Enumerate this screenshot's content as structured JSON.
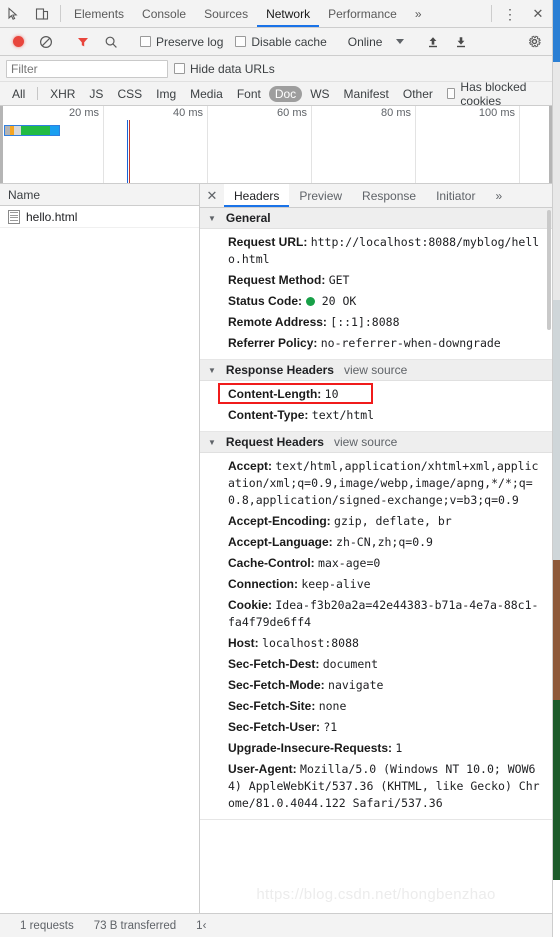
{
  "window": {
    "inspect_icon": "inspect-element-icon",
    "device_icon": "device-toolbar-icon",
    "more_tabs_icon": "»",
    "kebab_icon": "⋮",
    "close_icon": "✕"
  },
  "main_tabs": [
    {
      "label": "Elements",
      "active": false
    },
    {
      "label": "Console",
      "active": false
    },
    {
      "label": "Sources",
      "active": false
    },
    {
      "label": "Network",
      "active": true
    },
    {
      "label": "Performance",
      "active": false
    }
  ],
  "toolbar": {
    "record_icon": "record-button",
    "clear_icon": "clear-icon",
    "filter_icon": "filter-funnel-icon",
    "search_icon": "search-icon",
    "preserve_log_label": "Preserve log",
    "preserve_log_checked": false,
    "disable_cache_label": "Disable cache",
    "disable_cache_checked": false,
    "throttle_value": "Online",
    "import_icon": "import-har-icon",
    "export_icon": "export-har-icon",
    "settings_icon": "gear-icon"
  },
  "filter": {
    "placeholder": "Filter",
    "value": "",
    "hide_data_urls_label": "Hide data URLs",
    "hide_data_urls_checked": false
  },
  "type_filters": [
    {
      "label": "All",
      "selected": false
    },
    {
      "label": "XHR",
      "selected": false
    },
    {
      "label": "JS",
      "selected": false
    },
    {
      "label": "CSS",
      "selected": false
    },
    {
      "label": "Img",
      "selected": false
    },
    {
      "label": "Media",
      "selected": false
    },
    {
      "label": "Font",
      "selected": false
    },
    {
      "label": "Doc",
      "selected": true
    },
    {
      "label": "WS",
      "selected": false
    },
    {
      "label": "Manifest",
      "selected": false
    },
    {
      "label": "Other",
      "selected": false
    }
  ],
  "blocked_cookies": {
    "label": "Has blocked cookies",
    "checked": false
  },
  "overview": {
    "ticks": [
      "20 ms",
      "40 ms",
      "60 ms",
      "80 ms",
      "100 ms"
    ],
    "bar_segments": [
      {
        "name": "queueing",
        "color": "#b3b3b3",
        "width_pct": 9
      },
      {
        "name": "stalled",
        "color": "#f5a623",
        "width_pct": 7
      },
      {
        "name": "waiting",
        "color": "#d9d9d9",
        "width_pct": 13
      },
      {
        "name": "content-download",
        "color": "#22bb44",
        "width_pct": 54
      },
      {
        "name": "finish",
        "color": "#1a9ff0",
        "width_pct": 17
      }
    ],
    "event_lines": [
      {
        "name": "dom-content-loaded",
        "color": "#1a63d8",
        "left_pct": 24.5
      },
      {
        "name": "load",
        "color": "#c0392b",
        "left_pct": 25.1
      }
    ]
  },
  "request_list": {
    "column_header": "Name",
    "rows": [
      {
        "name": "hello.html",
        "icon": "document-icon",
        "selected": true
      }
    ]
  },
  "detail_tabs": [
    {
      "label": "Headers",
      "active": true
    },
    {
      "label": "Preview",
      "active": false
    },
    {
      "label": "Response",
      "active": false
    },
    {
      "label": "Initiator",
      "active": false
    }
  ],
  "detail_more_icon": "»",
  "sections": {
    "general": {
      "title": "General",
      "rows": [
        {
          "key": "Request URL:",
          "value": "http://localhost:8088/myblog/hello.html"
        },
        {
          "key": "Request Method:",
          "value": "GET"
        },
        {
          "key": "Status Code:",
          "value": "20 OK",
          "status_dot": "#18a048"
        },
        {
          "key": "Remote Address:",
          "value": "[::1]:8088"
        },
        {
          "key": "Referrer Policy:",
          "value": "no-referrer-when-downgrade"
        }
      ]
    },
    "response_headers": {
      "title": "Response Headers",
      "view_source": "view source",
      "rows": [
        {
          "key": "Content-Length:",
          "value": "10",
          "highlighted": true
        },
        {
          "key": "Content-Type:",
          "value": "text/html"
        }
      ]
    },
    "request_headers": {
      "title": "Request Headers",
      "view_source": "view source",
      "rows": [
        {
          "key": "Accept:",
          "value": "text/html,application/xhtml+xml,application/xml;q=0.9,image/webp,image/apng,*/*;q=0.8,application/signed-exchange;v=b3;q=0.9"
        },
        {
          "key": "Accept-Encoding:",
          "value": "gzip, deflate, br"
        },
        {
          "key": "Accept-Language:",
          "value": "zh-CN,zh;q=0.9"
        },
        {
          "key": "Cache-Control:",
          "value": "max-age=0"
        },
        {
          "key": "Connection:",
          "value": "keep-alive"
        },
        {
          "key": "Cookie:",
          "value": "Idea-f3b20a2a=42e44383-b71a-4e7a-88c1-fa4f79de6ff4"
        },
        {
          "key": "Host:",
          "value": "localhost:8088"
        },
        {
          "key": "Sec-Fetch-Dest:",
          "value": "document"
        },
        {
          "key": "Sec-Fetch-Mode:",
          "value": "navigate"
        },
        {
          "key": "Sec-Fetch-Site:",
          "value": "none"
        },
        {
          "key": "Sec-Fetch-User:",
          "value": "?1"
        },
        {
          "key": "Upgrade-Insecure-Requests:",
          "value": "1"
        },
        {
          "key": "User-Agent:",
          "value": "Mozilla/5.0 (Windows NT 10.0; WOW64) AppleWebKit/537.36 (KHTML, like Gecko) Chrome/81.0.4044.122 Safari/537.36"
        }
      ]
    }
  },
  "watermark": "https://blog.csdn.net/hongbenzhao",
  "status_bar": {
    "requests": "1 requests",
    "transferred": "73 B transferred",
    "resources": "1‹"
  },
  "colors": {
    "accent": "#1a73e8",
    "record_active": "#e8453c",
    "filter_active": "#e8453c",
    "status_ok": "#18a048",
    "annotation_box": "#f01b1b"
  }
}
